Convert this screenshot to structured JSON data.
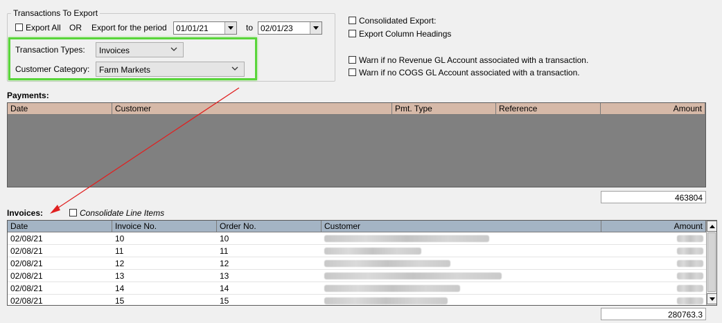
{
  "export_group": {
    "legend": "Transactions To Export",
    "export_all_label": "Export All",
    "or_label": "OR",
    "period_label": "Export for the period",
    "from_date": "01/01/21",
    "to_label": "to",
    "to_date": "02/01/23",
    "transaction_types_label": "Transaction Types:",
    "transaction_types_value": "Invoices",
    "customer_category_label": "Customer Category:",
    "customer_category_value": "Farm Markets"
  },
  "options": {
    "consolidated_export": "Consolidated Export:",
    "export_column_headings": "Export Column Headings",
    "warn_revenue": "Warn if no Revenue GL Account associated with a transaction.",
    "warn_cogs": "Warn if no COGS GL Account associated with a transaction."
  },
  "payments": {
    "title": "Payments:",
    "columns": [
      "Date",
      "Customer",
      "Pmt. Type",
      "Reference",
      "Amount"
    ],
    "total": "463804"
  },
  "invoices": {
    "title": "Invoices:",
    "consolidate_label": "Consolidate Line Items",
    "columns": [
      "Date",
      "Invoice No.",
      "Order No.",
      "Customer",
      "Amount"
    ],
    "rows": [
      {
        "date": "02/08/21",
        "invoice": "10",
        "order": "10"
      },
      {
        "date": "02/08/21",
        "invoice": "11",
        "order": "11"
      },
      {
        "date": "02/08/21",
        "invoice": "12",
        "order": "12"
      },
      {
        "date": "02/08/21",
        "invoice": "13",
        "order": "13"
      },
      {
        "date": "02/08/21",
        "invoice": "14",
        "order": "14"
      },
      {
        "date": "02/08/21",
        "invoice": "15",
        "order": "15"
      }
    ],
    "total": "280763.3"
  },
  "colors": {
    "highlight": "#59d53a",
    "arrow": "#e02020",
    "payments_header": "#d6b9a8",
    "invoices_header": "#a4b4c4",
    "payments_body": "#808080"
  },
  "icons": [
    "dropdown-arrow-icon",
    "chevron-down-icon",
    "scroll-up-icon",
    "scroll-down-icon"
  ]
}
